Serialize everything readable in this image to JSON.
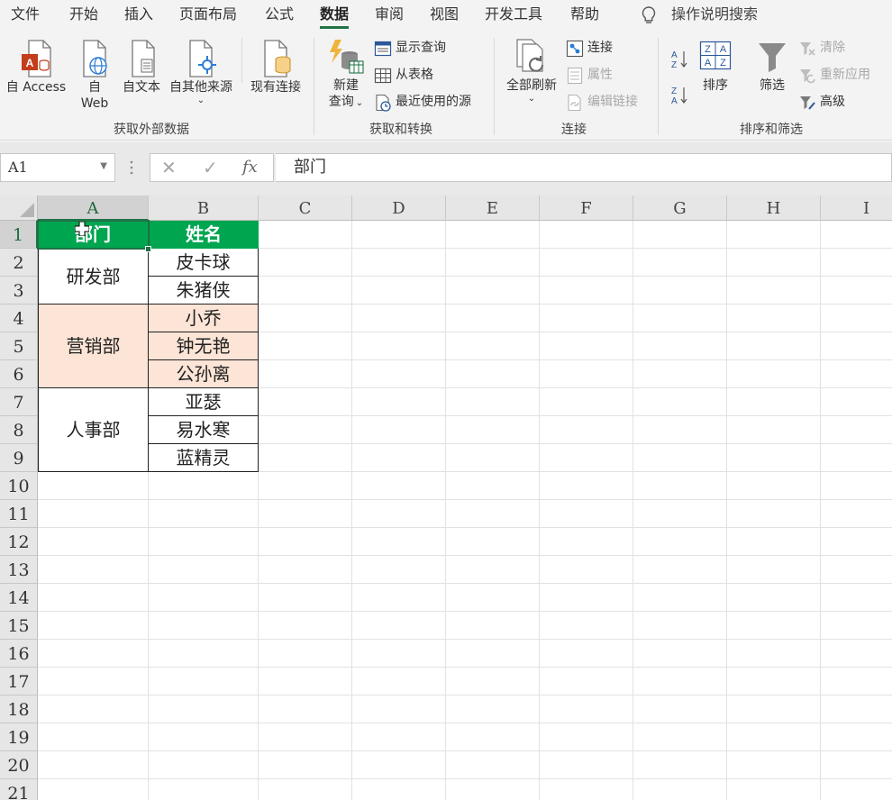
{
  "menu": {
    "tabs": [
      "文件",
      "开始",
      "插入",
      "页面布局",
      "公式",
      "数据",
      "审阅",
      "视图",
      "开发工具",
      "帮助"
    ],
    "active_tab": "数据",
    "tell_me": "操作说明搜索"
  },
  "ribbon": {
    "get_external": {
      "label": "获取外部数据",
      "access": "自 Access",
      "web_line1": "自",
      "web_line2": "Web",
      "text": "自文本",
      "other": "自其他来源",
      "existing": "现有连接"
    },
    "transform": {
      "label": "获取和转换",
      "new_query_line1": "新建",
      "new_query_line2": "查询",
      "show_queries": "显示查询",
      "from_table": "从表格",
      "recent_sources": "最近使用的源"
    },
    "connections": {
      "label": "连接",
      "refresh_all": "全部刷新",
      "connections": "连接",
      "properties": "属性",
      "edit_links": "编辑链接"
    },
    "sort_filter": {
      "label": "排序和筛选",
      "sort": "排序",
      "filter": "筛选",
      "clear": "清除",
      "reapply": "重新应用",
      "advanced": "高级"
    }
  },
  "formula_bar": {
    "name_box": "A1",
    "cancel": "✕",
    "enter": "✓",
    "fx": "fx",
    "content": "部门"
  },
  "sheet": {
    "columns": [
      "A",
      "B",
      "C",
      "D",
      "E",
      "F",
      "G",
      "H",
      "I"
    ],
    "rows": [
      "1",
      "2",
      "3",
      "4",
      "5",
      "6",
      "7",
      "8",
      "9",
      "10",
      "11",
      "12",
      "13",
      "14",
      "15",
      "16",
      "17",
      "18",
      "19",
      "20",
      "21"
    ],
    "header": {
      "dept": "部门",
      "name": "姓名"
    },
    "departments": [
      "研发部",
      "营销部",
      "人事部"
    ],
    "names": [
      "皮卡球",
      "朱猪侠",
      "小乔",
      "钟无艳",
      "公孙离",
      "亚瑟",
      "易水寒",
      "蓝精灵"
    ],
    "colors": {
      "header_fill": "#00A550",
      "highlight_fill": "#FCE4D6",
      "accent": "#217346"
    }
  }
}
